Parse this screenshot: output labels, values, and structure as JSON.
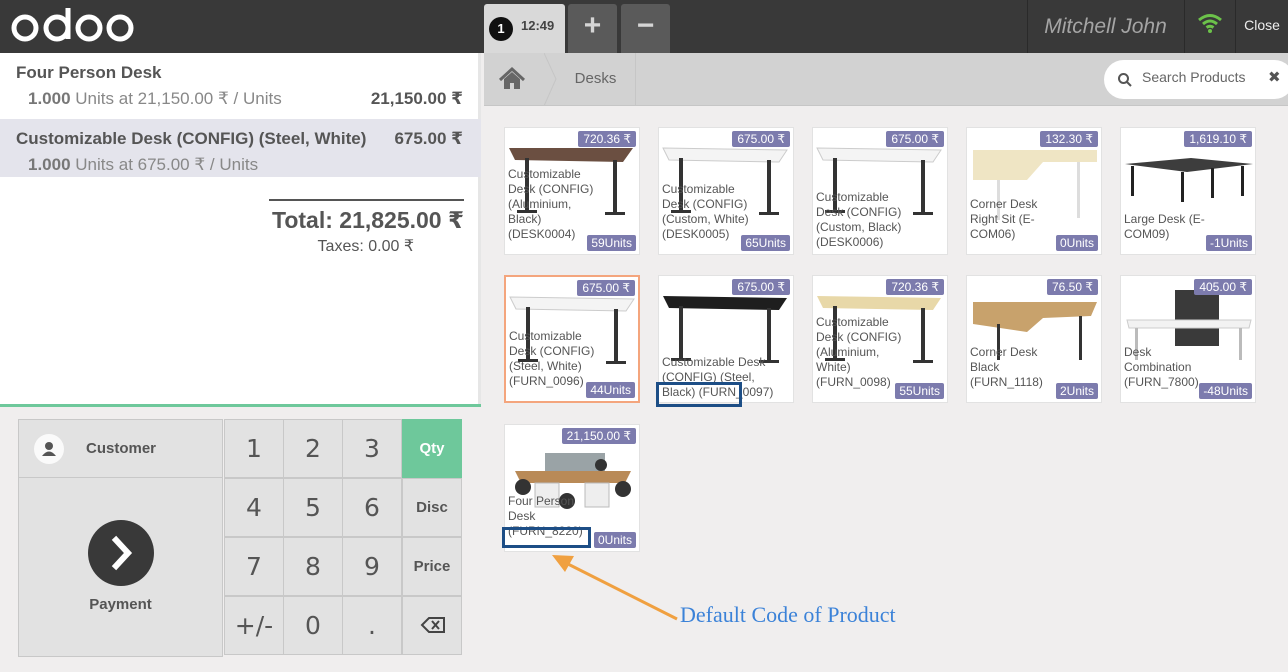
{
  "header": {
    "logo_text": "odoo",
    "order_number": "1",
    "order_time": "12:49",
    "add_label": "+",
    "remove_label": "−",
    "user_name": "Mitchell John",
    "close_label": "Close"
  },
  "order": {
    "lines": [
      {
        "name": "Four Person Desk",
        "qty": "1.000",
        "info": "Units at 21,150.00 ₹ / Units",
        "price": "21,150.00 ₹"
      },
      {
        "name": "Customizable Desk (CONFIG) (Steel, White)",
        "qty": "1.000",
        "info": "Units at 675.00 ₹ / Units",
        "price": "675.00 ₹"
      }
    ],
    "total": "Total: 21,825.00 ₹",
    "taxes": "Taxes: 0.00 ₹"
  },
  "actionpad": {
    "customer_label": "Customer",
    "payment_label": "Payment"
  },
  "numpad": {
    "keys": [
      "1",
      "2",
      "3",
      "4",
      "5",
      "6",
      "7",
      "8",
      "9",
      "+/-",
      "0",
      "."
    ],
    "modes": [
      "Qty",
      "Disc",
      "Price"
    ],
    "active_mode": "Qty"
  },
  "products_header": {
    "breadcrumb": "Desks",
    "search_placeholder": "Search Products",
    "clear_label": "✖"
  },
  "products": [
    {
      "name": "Customizable Desk (CONFIG) (Aluminium, Black) (DESK0004)",
      "price": "720.36 ₹",
      "stock": "59Units"
    },
    {
      "name": "Customizable Desk (CONFIG) (Custom, White) (DESK0005)",
      "price": "675.00 ₹",
      "stock": "65Units"
    },
    {
      "name": "Customizable Desk (CONFIG) (Custom, Black) (DESK0006)",
      "price": "675.00 ₹",
      "stock": ""
    },
    {
      "name": "Corner Desk Right Sit (E-COM06)",
      "price": "132.30 ₹",
      "stock": "0Units"
    },
    {
      "name": "Large Desk (E-COM09)",
      "price": "1,619.10 ₹",
      "stock": "-1Units"
    },
    {
      "name": "Customizable Desk (CONFIG) (Steel, White) (FURN_0096)",
      "price": "675.00 ₹",
      "stock": "44Units"
    },
    {
      "name": "Customizable Desk (CONFIG) (Steel, Black) (FURN_0097)",
      "price": "675.00 ₹",
      "stock": ""
    },
    {
      "name": "Customizable Desk (CONFIG) (Aluminium, White) (FURN_0098)",
      "price": "720.36 ₹",
      "stock": "55Units"
    },
    {
      "name": "Corner Desk Black (FURN_1118)",
      "price": "76.50 ₹",
      "stock": "2Units"
    },
    {
      "name": "Desk Combination (FURN_7800)",
      "price": "405.00 ₹",
      "stock": "-48Units"
    },
    {
      "name": "Four Person Desk (FURN_8220)",
      "price": "21,150.00 ₹",
      "stock": "0Units"
    }
  ],
  "annotation": {
    "text": "Default Code of Product",
    "color": "#3b82d8"
  },
  "colors": {
    "header_bg": "#393939",
    "accent_green": "#6ec89b",
    "tag_purple": "#7c7bad",
    "selected_border": "#f4a57d",
    "annotation_box": "#1d4e86",
    "arrow": "#f0a040"
  }
}
